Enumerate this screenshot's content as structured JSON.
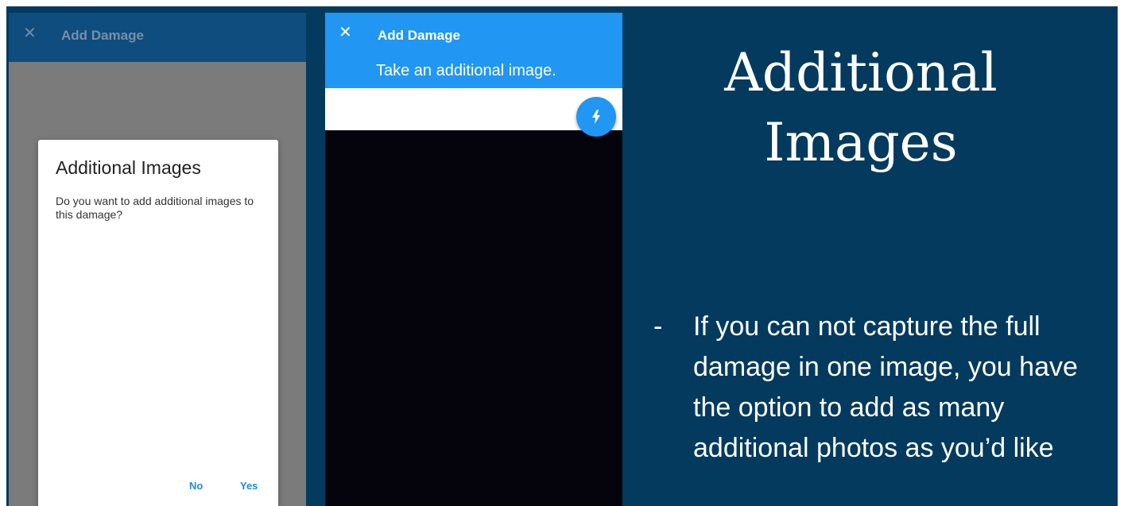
{
  "left_screen": {
    "appbar": {
      "close_glyph": "✕",
      "title": "Add Damage"
    },
    "dialog": {
      "title": "Additional Images",
      "message": "Do you want to add additional images to this damage?",
      "no_label": "No",
      "yes_label": "Yes"
    }
  },
  "middle_screen": {
    "appbar": {
      "close_glyph": "✕",
      "title": "Add Damage",
      "subtitle": "Take an additional image."
    },
    "flash_button_icon": "flash-icon"
  },
  "slide": {
    "heading": "Additional Images",
    "bullet_marker": "-",
    "bullet_text": "If you can not capture the full damage in one image, you have the option to add as many additional photos as you’d like"
  },
  "colors": {
    "slide_background": "#033a5e",
    "accent_blue": "#2196f3",
    "dim_overlay": "#7b7b7b"
  }
}
